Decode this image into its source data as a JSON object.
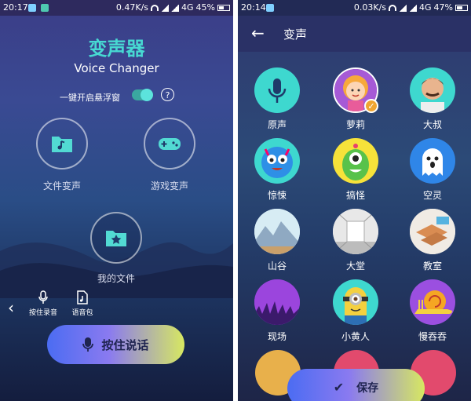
{
  "left_screen": {
    "status": {
      "time": "20:17",
      "speed": "0.47K/s",
      "network": "4G",
      "battery": "45%"
    },
    "title_cn": "变声器",
    "title_en": "Voice Changer",
    "float_toggle_label": "一键开启悬浮窗",
    "help_symbol": "?",
    "file_voice_label": "文件变声",
    "game_voice_label": "游戏变声",
    "my_files_label": "我的文件",
    "tools": [
      {
        "label": "按住录音",
        "icon": "microphone-icon"
      },
      {
        "label": "语音包",
        "icon": "music-file-icon"
      }
    ],
    "back_symbol": "‹",
    "hold_button_label": "按住说话"
  },
  "right_screen": {
    "status": {
      "time": "20:14",
      "speed": "0.03K/s",
      "network": "4G",
      "battery": "47%"
    },
    "header_title": "变声",
    "back_symbol": "←",
    "voices": [
      {
        "name": "原声",
        "icon": "microphone-icon",
        "selected": false
      },
      {
        "name": "萝莉",
        "icon": "girl-avatar",
        "selected": true
      },
      {
        "name": "大叔",
        "icon": "man-avatar",
        "selected": false
      },
      {
        "name": "惊悚",
        "icon": "blue-monster",
        "selected": false
      },
      {
        "name": "搞怪",
        "icon": "green-monster",
        "selected": false
      },
      {
        "name": "空灵",
        "icon": "ghost",
        "selected": false
      },
      {
        "name": "山谷",
        "icon": "mountain-scene",
        "selected": false
      },
      {
        "name": "大堂",
        "icon": "hall-scene",
        "selected": false
      },
      {
        "name": "教室",
        "icon": "classroom-scene",
        "selected": false
      },
      {
        "name": "现场",
        "icon": "concert-scene",
        "selected": false
      },
      {
        "name": "小黄人",
        "icon": "minion",
        "selected": false
      },
      {
        "name": "慢吞吞",
        "icon": "snail",
        "selected": false
      }
    ],
    "save_label": "保存"
  },
  "colors": {
    "accent_teal": "#47d9d2",
    "button_gradient_start": "#4b6cf2",
    "button_gradient_end": "#d7e861",
    "selected_badge": "#f0a531"
  }
}
